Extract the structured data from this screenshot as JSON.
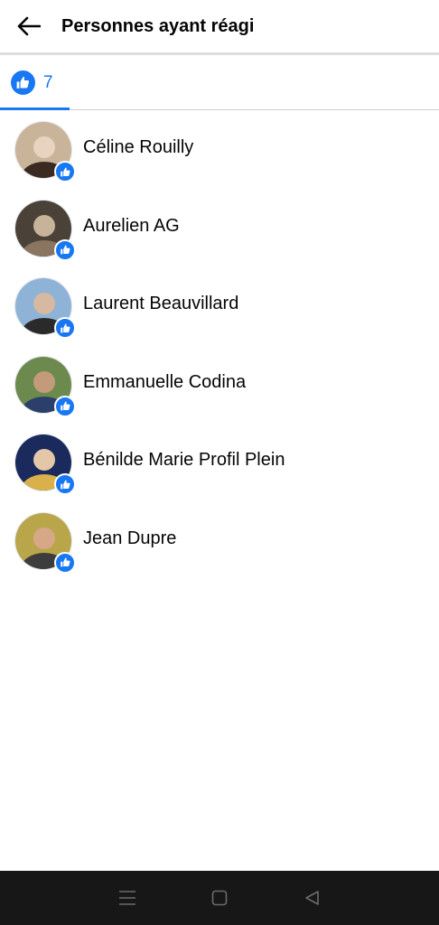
{
  "header": {
    "title": "Personnes ayant réagi"
  },
  "tabs": {
    "all_count": "7",
    "reaction_icon": "like-icon"
  },
  "people": [
    {
      "name": "Céline Rouilly",
      "reaction": "like",
      "avatar_colors": [
        "#c9b49a",
        "#3b2a22",
        "#e8d2c0"
      ]
    },
    {
      "name": "Aurelien AG",
      "reaction": "like",
      "avatar_colors": [
        "#4a4238",
        "#8a7560",
        "#c7b39a"
      ]
    },
    {
      "name": "Laurent Beauvillard",
      "reaction": "like",
      "avatar_colors": [
        "#8fb3d6",
        "#2a2a2a",
        "#d6b9a0"
      ]
    },
    {
      "name": "Emmanuelle Codina",
      "reaction": "like",
      "avatar_colors": [
        "#6d8a4e",
        "#2c3f6b",
        "#c49b7a"
      ]
    },
    {
      "name": "Bénilde Marie Profil Plein",
      "reaction": "like",
      "avatar_colors": [
        "#1a2a5c",
        "#d9b04a",
        "#e3c7a8"
      ]
    },
    {
      "name": "Jean Dupre",
      "reaction": "like",
      "avatar_colors": [
        "#b9a64a",
        "#3d3d3d",
        "#d7a888"
      ]
    }
  ],
  "colors": {
    "accent": "#1877f2",
    "text": "#050505",
    "divider": "#ced0d4",
    "navbar": "#171717"
  },
  "navbar": {
    "buttons": [
      "menu-icon",
      "home-icon",
      "back-triangle-icon"
    ]
  }
}
